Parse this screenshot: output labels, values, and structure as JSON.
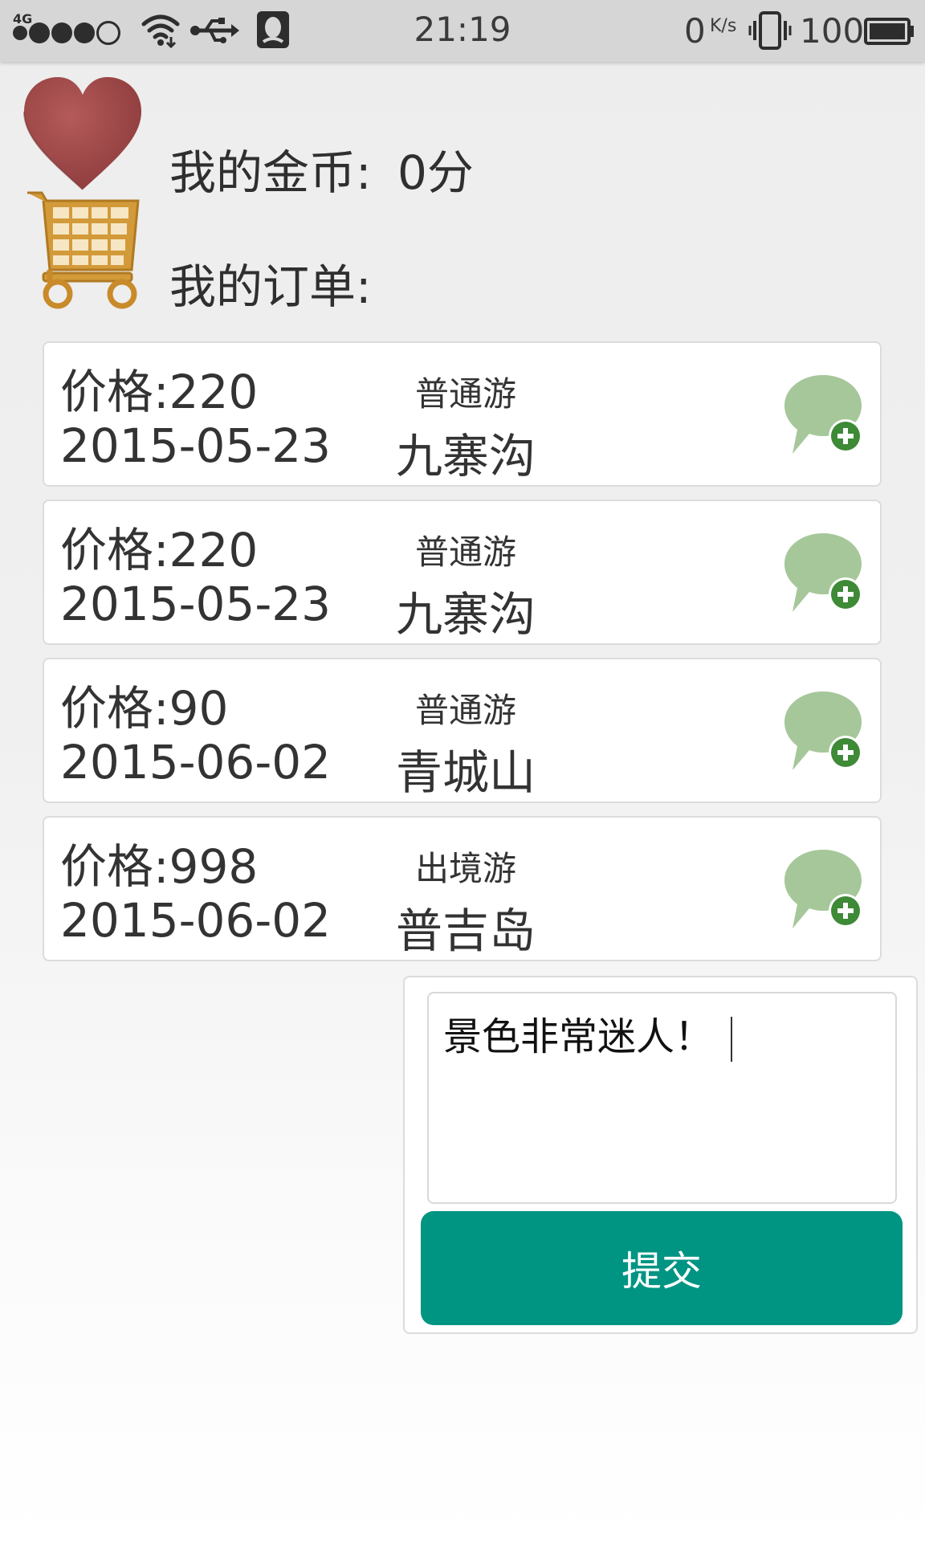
{
  "status_bar": {
    "network": "4G",
    "time": "21:19",
    "net_speed": "0",
    "net_speed_unit": "K/s",
    "battery": "100"
  },
  "profile": {
    "coins_label": "我的金币:",
    "coins_value": "0分",
    "orders_label": "我的订单:"
  },
  "orders": [
    {
      "price": "价格:220",
      "date": "2015-05-23",
      "type": "普通游",
      "destination": "九寨沟"
    },
    {
      "price": "价格:220",
      "date": "2015-05-23",
      "type": "普通游",
      "destination": "九寨沟"
    },
    {
      "price": "价格:90",
      "date": "2015-06-02",
      "type": "普通游",
      "destination": "青城山"
    },
    {
      "price": "价格:998",
      "date": "2015-06-02",
      "type": "出境游",
      "destination": "普吉岛"
    }
  ],
  "comment": {
    "text": "景色非常迷人！",
    "submit_label": "提交"
  },
  "colors": {
    "accent": "#009483",
    "heart": "#a04b4b",
    "cart": "#c98a2a",
    "comment_icon": "#a6c79a",
    "plus_badge": "#3e8a36"
  },
  "icons": [
    "heart-icon",
    "cart-icon",
    "comment-add-icon",
    "wifi-icon",
    "usb-icon",
    "qq-icon",
    "vibrate-icon",
    "battery-icon"
  ]
}
